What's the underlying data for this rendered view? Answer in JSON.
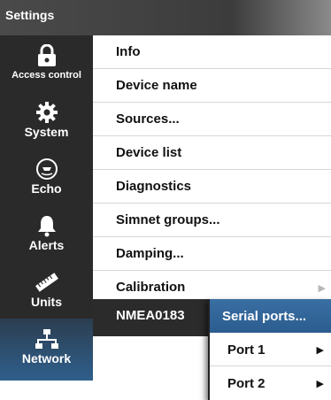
{
  "window": {
    "title": "Settings"
  },
  "sidebar": {
    "items": [
      {
        "label": "Access control",
        "icon": "lock-icon"
      },
      {
        "label": "System",
        "icon": "gear-icon"
      },
      {
        "label": "Echo",
        "icon": "sonar-icon"
      },
      {
        "label": "Alerts",
        "icon": "bell-icon"
      },
      {
        "label": "Units",
        "icon": "ruler-icon"
      },
      {
        "label": "Network",
        "icon": "network-icon",
        "active": true
      }
    ]
  },
  "menu": {
    "items": [
      {
        "label": "Info"
      },
      {
        "label": "Device name"
      },
      {
        "label": "Sources..."
      },
      {
        "label": "Device list"
      },
      {
        "label": "Diagnostics"
      },
      {
        "label": "Simnet groups..."
      },
      {
        "label": "Damping..."
      },
      {
        "label": "Calibration",
        "has_submenu": true
      },
      {
        "label": "NMEA0183",
        "selected": true
      }
    ]
  },
  "submenu": {
    "items": [
      {
        "label": "Serial ports...",
        "highlighted": true
      },
      {
        "label": "Port 1",
        "has_submenu": true
      },
      {
        "label": "Port 2",
        "has_submenu": true
      }
    ]
  },
  "colors": {
    "sidebar_bg": "#2a2a2a",
    "active_tab": "#2f5f8c",
    "selected_row": "#2b2b2b",
    "highlight": "#3a6fa3"
  }
}
